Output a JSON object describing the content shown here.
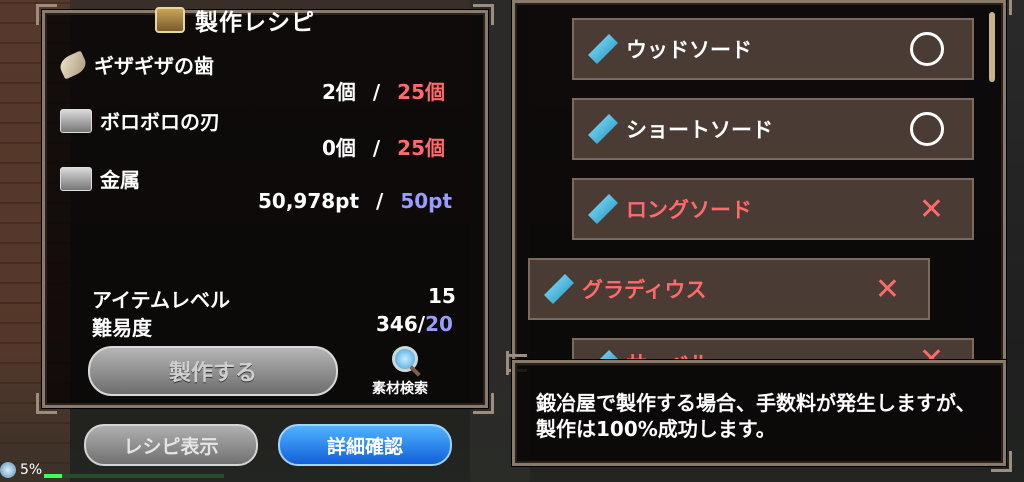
{
  "title": "製作レシピ",
  "materials": [
    {
      "name": "ギザギザの歯",
      "icon": "fang-icon",
      "have": "2個",
      "sep": "/",
      "need": "25個"
    },
    {
      "name": "ボロボロの刃",
      "icon": "metal-icon",
      "have": "0個",
      "sep": "/",
      "need": "25個"
    },
    {
      "name": "金属",
      "icon": "metal-icon",
      "have": "50,978pt",
      "sep": "/",
      "need": "50pt"
    }
  ],
  "stats": {
    "item_level_label": "アイテムレベル",
    "item_level_value": "15",
    "difficulty_label": "難易度",
    "difficulty_value": "346/",
    "difficulty_max": "20"
  },
  "buttons": {
    "craft": "製作する",
    "material_search": "素材検索",
    "recipe_display": "レシピ表示",
    "details": "詳細確認"
  },
  "recipes": [
    {
      "name": "ウッドソード",
      "mark": "○",
      "status": "ok"
    },
    {
      "name": "ショートソード",
      "mark": "○",
      "status": "ok"
    },
    {
      "name": "ロングソード",
      "mark": "✕",
      "status": "ng"
    },
    {
      "name": "グラディウス",
      "mark": "✕",
      "status": "ng"
    },
    {
      "name": "サーベル",
      "mark": "✕",
      "status": "ng"
    }
  ],
  "message": "鍛冶屋で製作する場合、手数料が発生しますが、製作は100%成功します。",
  "status": {
    "percent": "5%",
    "progress": 0.1
  },
  "colors": {
    "ng": "#ff6a6a",
    "ok": "#ffffff",
    "blue": "#9a9cff"
  }
}
